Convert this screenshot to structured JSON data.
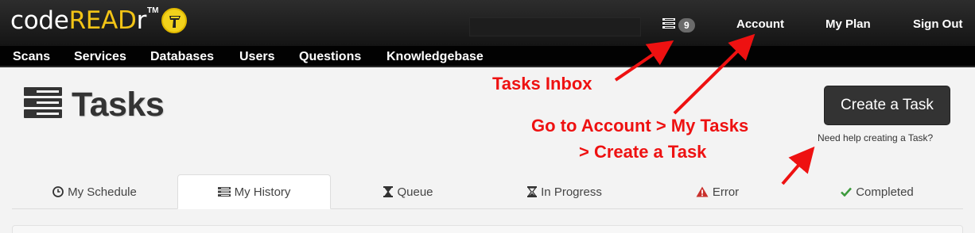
{
  "logo": {
    "part_a": "code",
    "part_b": "READ",
    "part_c": "r",
    "tm": "TM",
    "brand_yellow": "#f2c416"
  },
  "topbar": {
    "search_value": "",
    "inbox_icon": "tasks-list-icon",
    "inbox_count": "9",
    "links": [
      "Account",
      "My Plan",
      "Sign Out"
    ]
  },
  "nav": [
    "Scans",
    "Services",
    "Databases",
    "Users",
    "Questions",
    "Knowledgebase"
  ],
  "page": {
    "title": "Tasks",
    "title_icon": "tasks-list-icon",
    "create_button": "Create a Task",
    "help_link": "Need help creating a Task?"
  },
  "tabs": [
    {
      "label": "My Schedule",
      "icon": "clock-icon",
      "active": false
    },
    {
      "label": "My History",
      "icon": "tasks-list-icon",
      "active": true
    },
    {
      "label": "Queue",
      "icon": "hourglass-icon",
      "active": false
    },
    {
      "label": "In Progress",
      "icon": "hourglass-icon",
      "active": false
    },
    {
      "label": "Error",
      "icon": "warning-icon",
      "active": false
    },
    {
      "label": "Completed",
      "icon": "check-icon",
      "active": false
    }
  ],
  "annotations": {
    "tasks_inbox": "Tasks Inbox",
    "account_line1": "Go to Account > My Tasks",
    "account_line2": "> Create a Task",
    "color": "#ee1111"
  }
}
